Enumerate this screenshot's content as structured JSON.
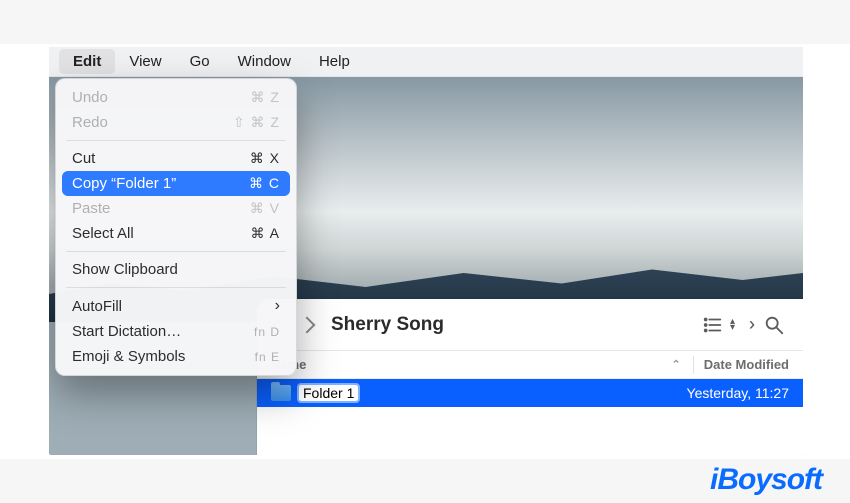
{
  "menubar": {
    "items": [
      "Edit",
      "View",
      "Go",
      "Window",
      "Help"
    ],
    "active_index": 0
  },
  "edit_menu": {
    "undo": {
      "label": "Undo",
      "shortcut": "⌘ Z",
      "enabled": false
    },
    "redo": {
      "label": "Redo",
      "shortcut": "⇧ ⌘ Z",
      "enabled": false
    },
    "cut": {
      "label": "Cut",
      "shortcut": "⌘ X",
      "enabled": true
    },
    "copy": {
      "label": "Copy “Folder 1”",
      "shortcut": "⌘ C",
      "enabled": true,
      "highlighted": true
    },
    "paste": {
      "label": "Paste",
      "shortcut": "⌘ V",
      "enabled": false
    },
    "select_all": {
      "label": "Select All",
      "shortcut": "⌘ A",
      "enabled": true
    },
    "show_clip": {
      "label": "Show Clipboard",
      "shortcut": "",
      "enabled": true
    },
    "autofill": {
      "label": "AutoFill",
      "shortcut": "",
      "submenu": true
    },
    "dictation": {
      "label": "Start Dictation…",
      "shortcut": "fn D",
      "enabled": true
    },
    "emoji": {
      "label": "Emoji & Symbols",
      "shortcut": "fn E",
      "enabled": true
    }
  },
  "finder": {
    "title": "Sherry Song",
    "columns": {
      "name": "Name",
      "date": "Date Modified"
    },
    "rows": [
      {
        "name": "Folder 1",
        "date": "Yesterday, 11:27",
        "selected": true,
        "editing": true
      }
    ]
  },
  "branding": {
    "logo": "iBoysoft"
  }
}
